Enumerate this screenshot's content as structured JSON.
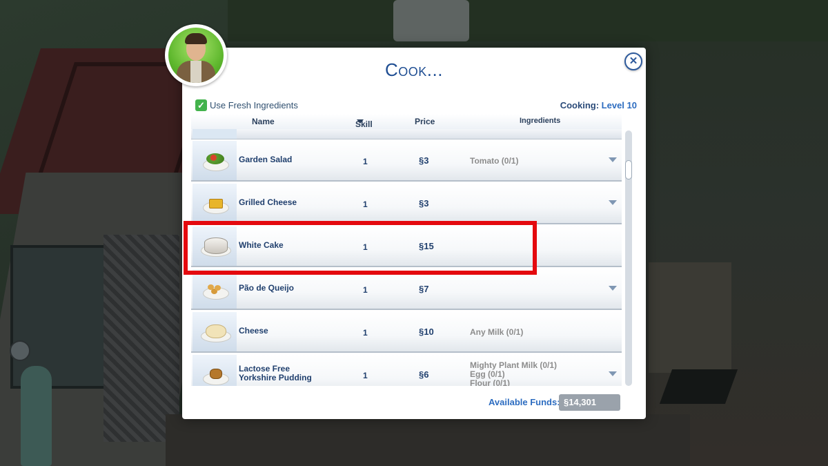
{
  "dialog": {
    "title": "Cook...",
    "close_icon": "close-icon",
    "fresh_ingredients_label": "Use Fresh Ingredients",
    "fresh_ingredients_checked": true,
    "skill_label": "Cooking:",
    "skill_level": "Level 10"
  },
  "columns": {
    "name": "Name",
    "skill": "Skill",
    "price": "Price",
    "ingredients": "Ingredients"
  },
  "recipes": [
    {
      "name": "Garden Salad",
      "skill": "1",
      "price": "§3",
      "ingredients": "Tomato (0/1)",
      "expandable": true,
      "icon": "salad-icon"
    },
    {
      "name": "Grilled Cheese",
      "skill": "1",
      "price": "§3",
      "ingredients": "",
      "expandable": true,
      "icon": "grilled-cheese-icon"
    },
    {
      "name": "White Cake",
      "skill": "1",
      "price": "§15",
      "ingredients": "",
      "expandable": false,
      "icon": "white-cake-icon",
      "highlighted": true
    },
    {
      "name": "Pão de Queijo",
      "skill": "1",
      "price": "§7",
      "ingredients": "",
      "expandable": true,
      "icon": "cheese-bread-icon"
    },
    {
      "name": "Cheese",
      "skill": "1",
      "price": "§10",
      "ingredients": "Any Milk (0/1)",
      "expandable": false,
      "icon": "cheese-icon"
    },
    {
      "name_line1": "Lactose Free",
      "name_line2": "Yorkshire Pudding",
      "skill": "1",
      "price": "§6",
      "ingredients_lines": [
        "Mighty Plant Milk (0/1)",
        "Egg (0/1)",
        "Flour (0/1)"
      ],
      "expandable": true,
      "icon": "pudding-icon"
    }
  ],
  "funds": {
    "label": "Available Funds:",
    "value": "§14,301"
  },
  "colors": {
    "highlight": "#e4090e",
    "title_blue": "#1e4d92",
    "check_green": "#43b34c"
  }
}
